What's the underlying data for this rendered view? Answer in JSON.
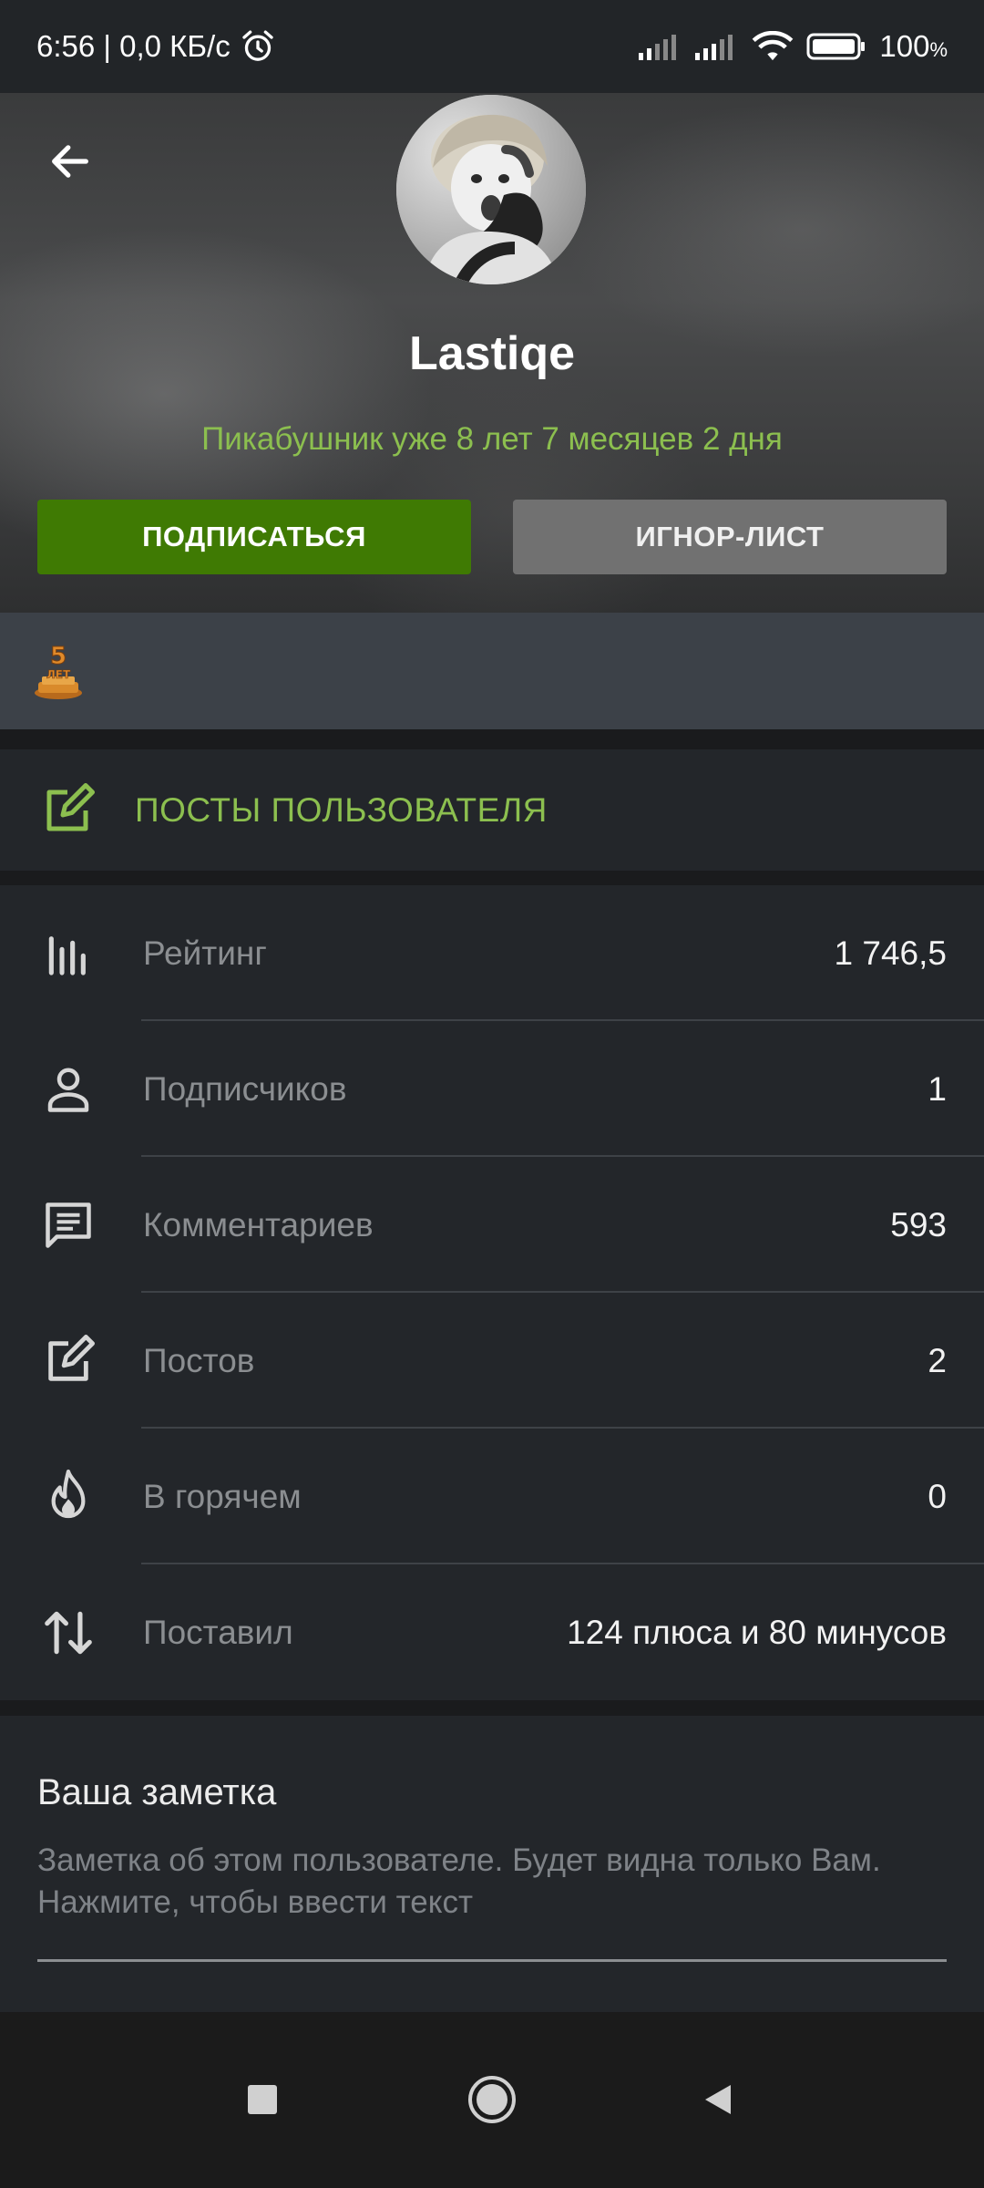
{
  "status_bar": {
    "time_speed": "6:56 | 0,0 КБ/с",
    "battery": "100",
    "battery_unit": "%",
    "icons": [
      "alarm-icon",
      "signal-icon",
      "signal-icon",
      "wifi-icon",
      "battery-icon"
    ]
  },
  "profile": {
    "username": "Lastiqe",
    "member_since": "Пикабушник уже 8 лет 7 месяцев 2 дня",
    "subscribe_label": "ПОДПИСАТЬСЯ",
    "ignore_label": "ИГНОР-ЛИСТ",
    "award_text": "5\nЛЕТ"
  },
  "posts_link": {
    "label": "ПОСТЫ ПОЛЬЗОВАТЕЛЯ",
    "icon": "edit-icon"
  },
  "stats": [
    {
      "icon": "chart-icon",
      "label": "Рейтинг",
      "value": "1 746,5"
    },
    {
      "icon": "person-icon",
      "label": "Подписчиков",
      "value": "1"
    },
    {
      "icon": "comment-icon",
      "label": "Комментариев",
      "value": "593"
    },
    {
      "icon": "edit-icon",
      "label": "Постов",
      "value": "2"
    },
    {
      "icon": "flame-icon",
      "label": "В горячем",
      "value": "0"
    },
    {
      "icon": "sort-arrows-icon",
      "label": "Поставил",
      "value": "124 плюса и 80 минусов"
    }
  ],
  "note": {
    "title": "Ваша заметка",
    "hint": "Заметка об этом пользователе. Будет видна только Вам. Нажмите, чтобы ввести текст"
  },
  "colors": {
    "accent_green": "#8cbf4f",
    "subscribe_bg": "#3f7a03",
    "ignore_bg": "#717171",
    "panel_bg": "#23262a"
  }
}
